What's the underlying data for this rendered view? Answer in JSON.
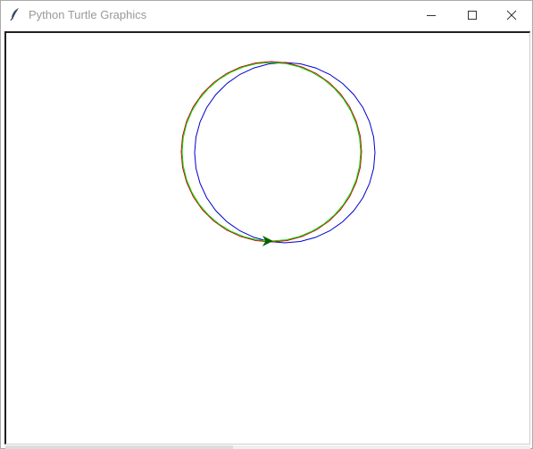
{
  "window": {
    "title": "Python Turtle Graphics"
  },
  "controls": {
    "minimize": "minimize-icon",
    "maximize": "maximize-icon",
    "close": "close-icon"
  },
  "canvas": {
    "background": "#ffffff",
    "circles": [
      {
        "name": "blue-circle",
        "color": "#0000cc"
      },
      {
        "name": "red-circle",
        "color": "#cc0000"
      },
      {
        "name": "green-circle",
        "color": "#00dd00"
      }
    ],
    "turtle_color": "#006400"
  }
}
